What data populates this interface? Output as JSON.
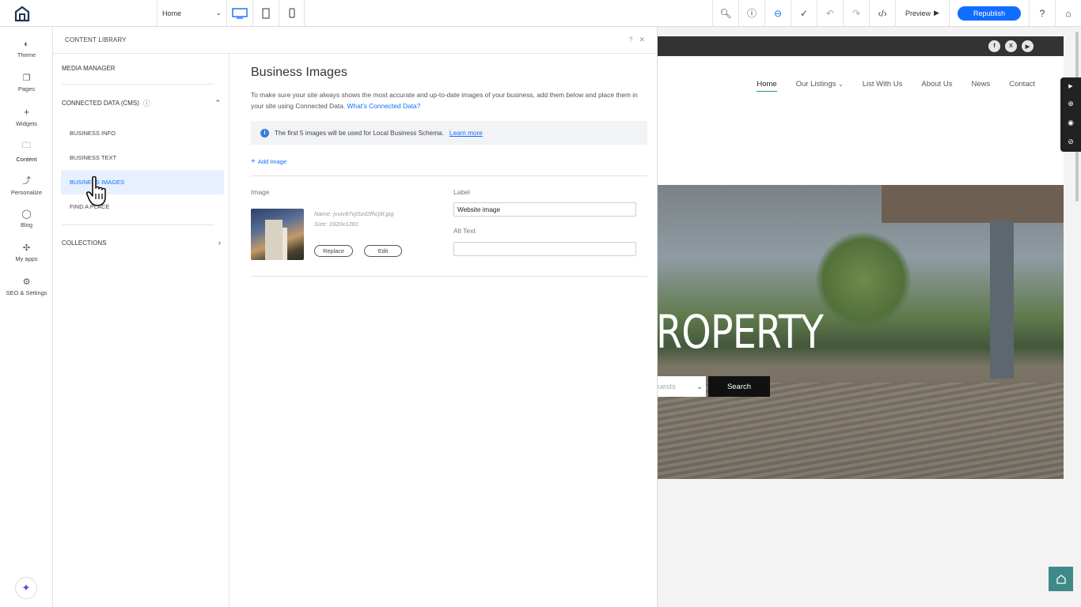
{
  "topbar": {
    "page_select": "Home",
    "preview": "Preview",
    "republish": "Republish"
  },
  "leftbar": [
    {
      "label": "Theme",
      "icon": "palette-icon"
    },
    {
      "label": "Pages",
      "icon": "pages-icon"
    },
    {
      "label": "Widgets",
      "icon": "plus-icon"
    },
    {
      "label": "Content",
      "icon": "folder-icon"
    },
    {
      "label": "Personalize",
      "icon": "personalize-icon"
    },
    {
      "label": "Blog",
      "icon": "chat-icon"
    },
    {
      "label": "My apps",
      "icon": "puzzle-icon"
    },
    {
      "label": "SEO & Settings",
      "icon": "gear-icon"
    }
  ],
  "panel": {
    "title": "CONTENT LIBRARY",
    "media_manager": "MEDIA MANAGER",
    "connected_data": "CONNECTED DATA (CMS)",
    "sub_items": [
      "BUSINESS INFO",
      "BUSINESS TEXT",
      "BUSINESS IMAGES",
      "FIND A PLACE"
    ],
    "collections": "COLLECTIONS"
  },
  "main": {
    "title": "Business Images",
    "desc": "To make sure your site always shows the most accurate and up-to-date images of your business, add them below and place them in your site using Connected Data.",
    "desc_link": "What's Connected Data?",
    "info": "The first 5 images will be used for Local Business Schema.",
    "info_link": "Learn more",
    "add_image": "Add Image",
    "col_image": "Image",
    "col_label": "Label",
    "file_name": "Name: jvuiv87vji5zd2fhcj9l.jpg",
    "file_size": "Size: 1920x1281",
    "replace": "Replace",
    "edit": "Edit",
    "label_value": "Website image",
    "alt_text_label": "Alt Text",
    "alt_text_value": ""
  },
  "site": {
    "nav": [
      "Home",
      "Our Listings",
      "List With Us",
      "About Us",
      "News",
      "Contact"
    ],
    "hero_title": "ROPERTY",
    "guests": "uests",
    "search": "Search",
    "social": [
      "f",
      "X",
      "▶"
    ]
  },
  "colors": {
    "accent": "#116dff",
    "site_accent": "#3f8a88"
  }
}
